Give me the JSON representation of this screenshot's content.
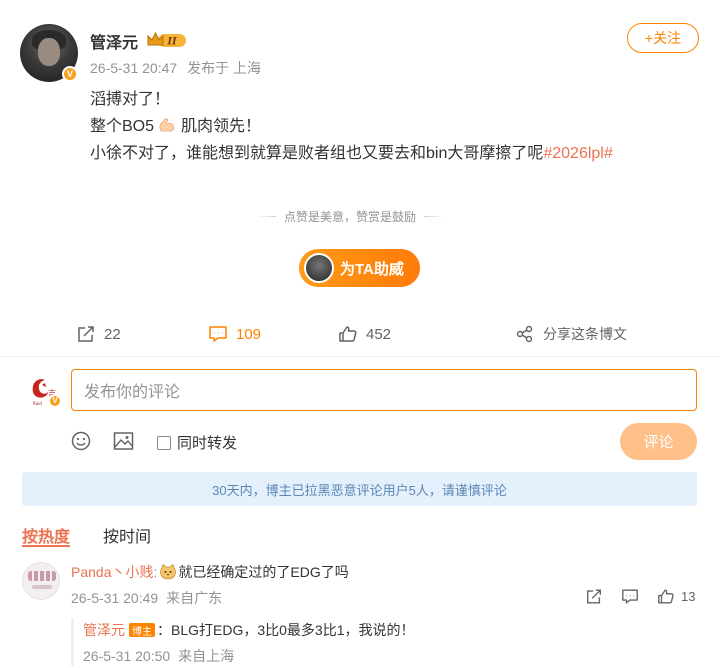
{
  "post": {
    "author": "管泽元",
    "time": "26-5-31 20:47",
    "location": "发布于 上海",
    "follow_label": "+关注",
    "lines": [
      "滔搏对了！",
      "整个BO5",
      "肌肉领先！",
      "小徐不对了，谁能想到就算是败者组也又要去和bin大哥摩擦了呢"
    ],
    "hashtag": "#2026lpl#",
    "reward_tip": "点赞是美意，赞赏是鼓励",
    "cheer_label": "为TA助威"
  },
  "actions": {
    "repost_count": "22",
    "comment_count": "109",
    "like_count": "452",
    "share_label": "分享这条博文"
  },
  "composer": {
    "placeholder": "发布你的评论",
    "repost_label": "同时转发",
    "submit_label": "评论"
  },
  "notice": "30天内，博主已拉黑恶意评论用户5人，请谨慎评论",
  "sort": {
    "hot_label": "按热度",
    "time_label": "按时间"
  },
  "comments": [
    {
      "user": "Panda丶小贱",
      "text": "就已经确定过的了EDG了吗",
      "time": "26-5-31 20:49",
      "location": "来自广东",
      "likes": "13",
      "reply": {
        "user": "管泽元",
        "badge": "博主",
        "text": "：BLG打EDG，3比0最多3比1，我说的！",
        "time": "26-5-31 20:50",
        "location": "来自上海"
      }
    }
  ],
  "colors": {
    "accent": "#ff8200",
    "link": "#eb7350",
    "notice_bg": "#e4f0fb",
    "notice_text": "#5b87b5"
  },
  "icons": [
    "crown-badge-icon",
    "verified-icon",
    "muscle-emoji-icon",
    "repost-icon",
    "comment-icon",
    "like-icon",
    "share-icon",
    "emoji-icon",
    "image-icon",
    "cat-emoji-icon"
  ]
}
